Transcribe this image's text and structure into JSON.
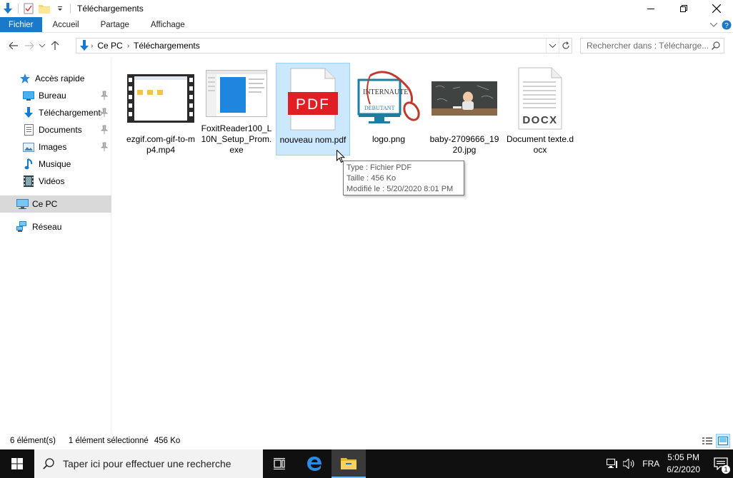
{
  "window": {
    "title": "Téléchargements"
  },
  "ribbon": {
    "tabs": [
      "Fichier",
      "Accueil",
      "Partage",
      "Affichage"
    ]
  },
  "address": {
    "crumbs": [
      "Ce PC",
      "Téléchargements"
    ]
  },
  "search": {
    "placeholder": "Rechercher dans : Télécharge..."
  },
  "sidebar": {
    "items": [
      {
        "label": "Accès rapide",
        "icon": "star-icon",
        "pinned": false
      },
      {
        "label": "Bureau",
        "icon": "desktop-icon",
        "pinned": true
      },
      {
        "label": "Téléchargements",
        "icon": "download-icon",
        "pinned": true
      },
      {
        "label": "Documents",
        "icon": "document-icon",
        "pinned": true
      },
      {
        "label": "Images",
        "icon": "image-icon",
        "pinned": true
      },
      {
        "label": "Musique",
        "icon": "music-icon",
        "pinned": false
      },
      {
        "label": "Vidéos",
        "icon": "video-icon",
        "pinned": false
      },
      {
        "label": "Ce PC",
        "icon": "computer-icon",
        "pinned": false,
        "selected": true
      },
      {
        "label": "Réseau",
        "icon": "network-icon",
        "pinned": false
      }
    ]
  },
  "files": [
    {
      "name": "ezgif.com-gif-to-mp4.mp4",
      "kind": "video"
    },
    {
      "name": "FoxitReader100_L10N_Setup_Prom.exe",
      "kind": "exe"
    },
    {
      "name": "nouveau nom.pdf",
      "kind": "pdf",
      "selected": true
    },
    {
      "name": "logo.png",
      "kind": "png"
    },
    {
      "name": "baby-2709666_1920.jpg",
      "kind": "jpg"
    },
    {
      "name": "Document texte.docx",
      "kind": "docx"
    }
  ],
  "thumbnails": {
    "pdf_label": "PDF",
    "docx_label": "DOCX",
    "logo_line1": "INTERNAUTE",
    "logo_line2": "DEBUTANT"
  },
  "tooltip": {
    "type": "Type : Fichier PDF",
    "size": "Taille : 456 Ko",
    "modified": "Modifié le : 5/20/2020 8:01 PM"
  },
  "status": {
    "count": "6 élément(s)",
    "selected": "1 élément sélectionné",
    "size": "456 Ko"
  },
  "taskbar": {
    "search_placeholder": "Taper ici pour effectuer une recherche",
    "lang": "FRA",
    "time": "5:05 PM",
    "date": "6/2/2020",
    "notification_count": "1"
  },
  "colors": {
    "accent": "#1979ca",
    "selection": "#cce8ff",
    "taskbar": "#101010",
    "pdf_red": "#e01e24"
  }
}
